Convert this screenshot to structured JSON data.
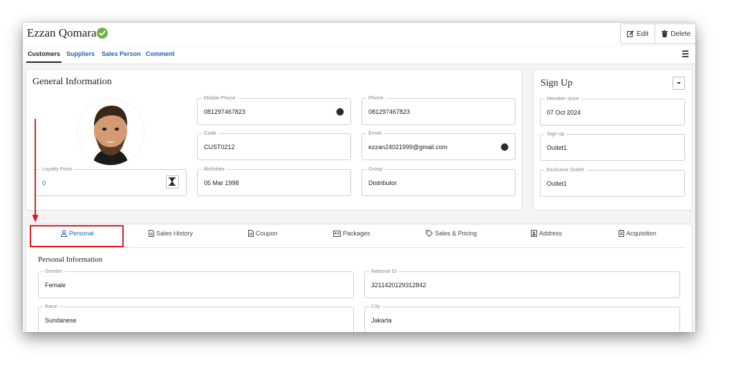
{
  "header": {
    "title": "Ezzan Qomara",
    "edit_label": "Edit",
    "delete_label": "Delete"
  },
  "tabs": [
    {
      "label": "Customers",
      "active": true
    },
    {
      "label": "Suppliers"
    },
    {
      "label": "Sales Person"
    },
    {
      "label": "Comment"
    }
  ],
  "general": {
    "title": "General Information",
    "loyalty": {
      "label": "Loyalty Point",
      "value": "0"
    },
    "mobile_phone": {
      "label": "Mobile Phone",
      "value": "081297467823"
    },
    "phone": {
      "label": "Phone",
      "value": "081297467823"
    },
    "code": {
      "label": "Code",
      "value": "CUST0212"
    },
    "email": {
      "label": "Email",
      "value": "ezzan24021999@gmail.com"
    },
    "birthdate": {
      "label": "Birthdate",
      "value": "05 Mar 1998"
    },
    "group": {
      "label": "Group",
      "value": "Distributor"
    }
  },
  "signup": {
    "title": "Sign Up",
    "member_since": {
      "label": "Member since",
      "value": "07 Oct 2024"
    },
    "sign_up": {
      "label": "Sign up",
      "value": "Outlet1"
    },
    "exclusive_outlet": {
      "label": "Exclusive Outlet",
      "value": "Outlet1"
    }
  },
  "profile_tabs": [
    {
      "label": "Personal",
      "icon": "person-icon",
      "active": true
    },
    {
      "label": "Sales History",
      "icon": "document-icon"
    },
    {
      "label": "Coupon",
      "icon": "document-icon"
    },
    {
      "label": "Packages",
      "icon": "id-card-icon"
    },
    {
      "label": "Sales & Pricing",
      "icon": "tag-icon"
    },
    {
      "label": "Address",
      "icon": "contact-card-icon"
    },
    {
      "label": "Acquisition",
      "icon": "clipboard-icon"
    }
  ],
  "personal": {
    "title": "Personal Information",
    "gender": {
      "label": "Gender",
      "value": "Female"
    },
    "national_id": {
      "label": "National ID",
      "value": "3211420129312842"
    },
    "race": {
      "label": "Race",
      "value": "Sundanese"
    },
    "city": {
      "label": "City",
      "value": "Jakarta"
    }
  },
  "colors": {
    "accent_link": "#1c63b0",
    "verified_green": "#6eb43f",
    "annotation_red": "#e5171c"
  }
}
